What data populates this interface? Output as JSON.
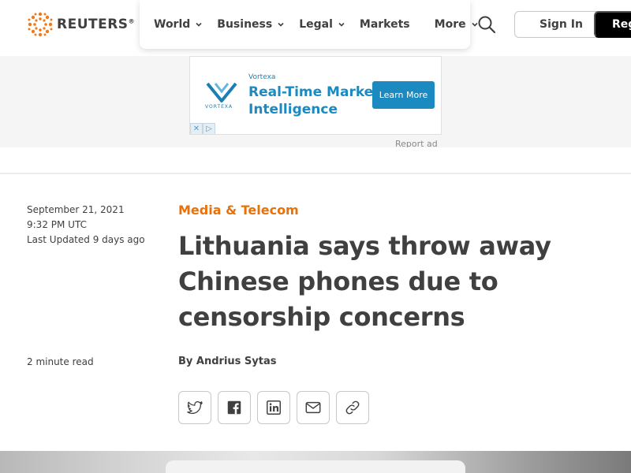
{
  "header": {
    "logo_text": "REUTERS",
    "logo_reg": "®",
    "nav": [
      {
        "label": "World",
        "has_dropdown": true
      },
      {
        "label": "Business",
        "has_dropdown": true
      },
      {
        "label": "Legal",
        "has_dropdown": true
      },
      {
        "label": "Markets",
        "has_dropdown": false
      },
      {
        "label": "More",
        "has_dropdown": true
      }
    ],
    "signin_label": "Sign In",
    "register_label": "Register"
  },
  "ad": {
    "logo_text": "VORTEXA",
    "brand": "Vortexa",
    "headline_line1": "Real-Time Market",
    "headline_line2": "Intelligence",
    "cta": "Learn More",
    "report_label": "Report ad"
  },
  "article": {
    "date": "September 21, 2021",
    "time": "9:32 PM UTC",
    "updated": "Last Updated 9 days ago",
    "read_time": "2 minute read",
    "section": "Media & Telecom",
    "headline": "Lithuania says throw away Chinese phones due to censorship concerns",
    "byline": "By Andrius Sytas"
  },
  "share": [
    "twitter-icon",
    "facebook-icon",
    "linkedin-icon",
    "email-icon",
    "link-icon"
  ],
  "colors": {
    "accent": "#e8710a",
    "text": "#404040",
    "ad_blue": "#1b8ac0"
  }
}
